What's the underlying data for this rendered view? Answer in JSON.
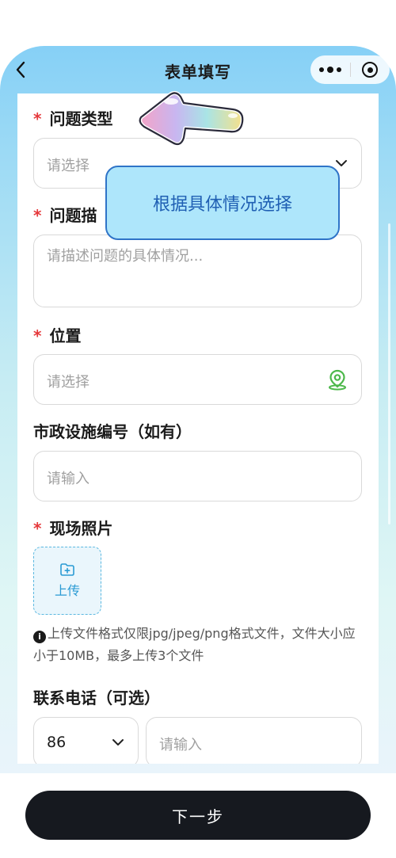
{
  "nav": {
    "title": "表单填写",
    "back_icon": "chevron-left-icon",
    "more_icon": "more-dots-icon",
    "close_icon": "target-circle-icon"
  },
  "form": {
    "problem_type": {
      "required_mark": "*",
      "label": "问题类型",
      "placeholder": "请选择"
    },
    "problem_desc": {
      "required_mark": "*",
      "label": "问题描",
      "placeholder": "请描述问题的具体情况..."
    },
    "location": {
      "required_mark": "*",
      "label": "位置",
      "placeholder": "请选择"
    },
    "facility_no": {
      "label": "市政设施编号（如有）",
      "placeholder": "请输入"
    },
    "photos": {
      "required_mark": "*",
      "label": "现场照片",
      "upload_label": "上传",
      "hint": "上传文件格式仅限jpg/jpeg/png格式文件，文件大小应小于10MB，最多上传3个文件",
      "hint_icon": "i"
    },
    "phone": {
      "label": "联系电话（可选）",
      "country_code": "86",
      "placeholder": "请输入"
    }
  },
  "tooltip": {
    "text": "根据具体情况选择"
  },
  "footer": {
    "next_label": "下一步"
  },
  "colors": {
    "accent": "#2b9bd4",
    "required": "#e5383b",
    "location_icon": "#4cb84a",
    "button_bg": "#16191f"
  }
}
